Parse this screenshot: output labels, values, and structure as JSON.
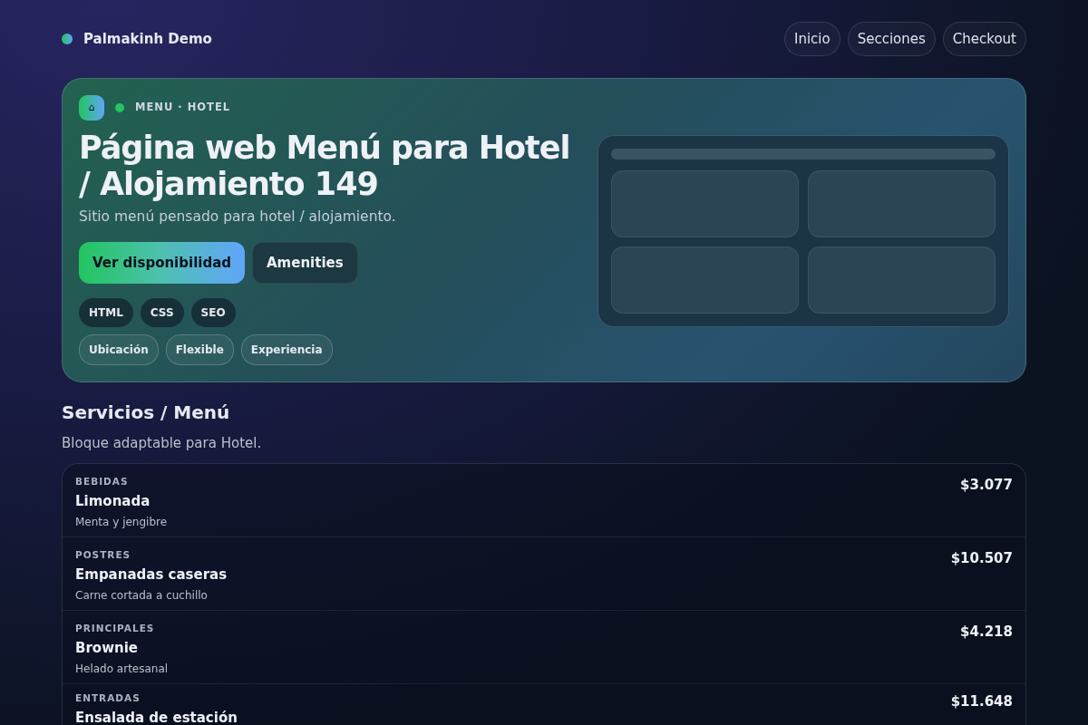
{
  "brand": {
    "name": "Palmakinh Demo"
  },
  "nav": [
    {
      "label": "Inicio"
    },
    {
      "label": "Secciones"
    },
    {
      "label": "Checkout"
    }
  ],
  "hero": {
    "icon_glyph": "⌂",
    "eyebrow": "MENU · HOTEL",
    "title": "Página web Menú para Hotel / Alojamiento 149",
    "subtitle": "Sitio menú pensado para hotel / alojamiento.",
    "buttons": [
      {
        "label": "Ver disponibilidad",
        "kind": "primary"
      },
      {
        "label": "Amenities",
        "kind": "secondary"
      }
    ],
    "tech_tags": [
      "HTML",
      "CSS",
      "SEO"
    ],
    "feature_tags": [
      "Ubicación",
      "Flexible",
      "Experiencia"
    ]
  },
  "section": {
    "title": "Servicios / Menú",
    "subtitle": "Bloque adaptable para Hotel."
  },
  "menu_items": [
    {
      "category": "BEBIDAS",
      "name": "Limonada",
      "description": "Menta y jengibre",
      "price": "$3.077"
    },
    {
      "category": "POSTRES",
      "name": "Empanadas caseras",
      "description": "Carne cortada a cuchillo",
      "price": "$10.507"
    },
    {
      "category": "PRINCIPALES",
      "name": "Brownie",
      "description": "Helado artesanal",
      "price": "$4.218"
    },
    {
      "category": "ENTRADAS",
      "name": "Ensalada de estación",
      "price": "$11.648"
    }
  ]
}
